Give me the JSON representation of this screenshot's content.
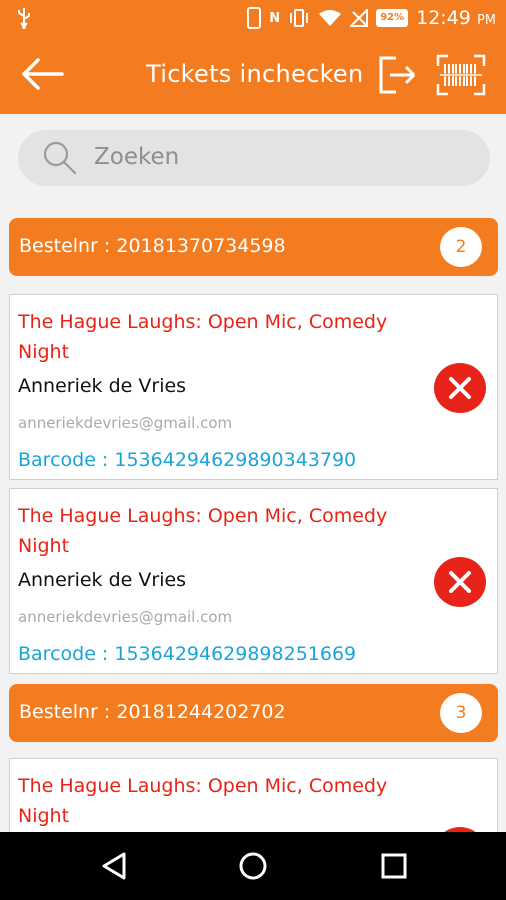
{
  "status": {
    "time": "12:49",
    "ampm": "PM",
    "battery": "92%",
    "icons": [
      "usb-icon",
      "phone-icon",
      "nfc-icon",
      "vibrate-icon",
      "wifi-icon",
      "no-signal-icon",
      "battery-icon"
    ]
  },
  "appbar": {
    "title": "Tickets inchecken",
    "icons": [
      "arrow-left-icon",
      "logout-icon",
      "barcode-scan-icon"
    ]
  },
  "search": {
    "placeholder": "Zoeken"
  },
  "orders": [
    {
      "label": "Bestelnr : 20181370734598",
      "count": "2",
      "tickets": [
        {
          "event": "The Hague Laughs: Open Mic, Comedy Night",
          "name": "Anneriek de Vries",
          "email": "anneriekdevries@gmail.com",
          "barcode": "Barcode : 15364294629890343790"
        },
        {
          "event": "The Hague Laughs: Open Mic, Comedy Night",
          "name": "Anneriek de Vries",
          "email": "anneriekdevries@gmail.com",
          "barcode": "Barcode : 15364294629898251669"
        }
      ]
    },
    {
      "label": "Bestelnr : 20181244202702",
      "count": "3",
      "tickets": [
        {
          "event": "The Hague Laughs: Open Mic, Comedy Night"
        }
      ]
    }
  ],
  "colors": {
    "brand": "#f47c20",
    "event_text": "#e62418",
    "barcode_text": "#1ba4d8",
    "cancel": "#e8241a"
  }
}
